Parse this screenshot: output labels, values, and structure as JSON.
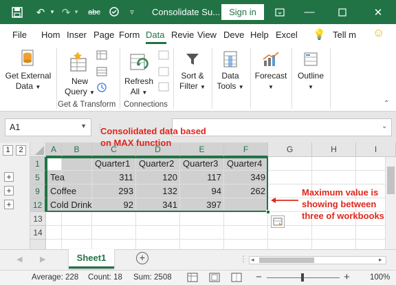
{
  "titlebar": {
    "doc_title": "Consolidate Su...",
    "signin_label": "Sign in",
    "save_icon": "save-icon",
    "undo_icon": "undo-icon",
    "redo_icon": "redo-icon",
    "spelling_label": "abc",
    "accent": "#217346"
  },
  "tabs": [
    "File",
    "Hom",
    "Inser",
    "Page",
    "Form",
    "Data",
    "Revie",
    "View",
    "Deve",
    "Help",
    "Excel"
  ],
  "active_tab": "Data",
  "tell_me": "Tell m",
  "ribbon": {
    "get_external": [
      "Get External",
      "Data"
    ],
    "new_query": [
      "New",
      "Query"
    ],
    "refresh": [
      "Refresh",
      "All"
    ],
    "sort_filter": [
      "Sort &",
      "Filter"
    ],
    "data_tools": [
      "Data",
      "Tools"
    ],
    "forecast": "Forecast",
    "outline": "Outline",
    "group_get_transform": "Get & Transform",
    "group_connections": "Connections"
  },
  "formula_bar": {
    "name_box": "A1",
    "fx_value": ""
  },
  "outline_levels": [
    "1",
    "2"
  ],
  "columns": [
    "A",
    "B",
    "C",
    "D",
    "E",
    "F",
    "G",
    "H",
    "I"
  ],
  "rows": [
    "1",
    "5",
    "9",
    "12",
    "13",
    "14"
  ],
  "table": {
    "headers": [
      "Quarter1",
      "Quarter2",
      "Quarter3",
      "Quarter4"
    ],
    "data": [
      {
        "label": "Tea",
        "values": [
          "311",
          "120",
          "117",
          "349"
        ]
      },
      {
        "label": "Coffee",
        "values": [
          "293",
          "132",
          "94",
          "262"
        ]
      },
      {
        "label": "Cold Drink",
        "values": [
          "92",
          "341",
          "397",
          ""
        ]
      }
    ]
  },
  "sheet_tab": "Sheet1",
  "status": {
    "average": "Average: 228",
    "count": "Count: 18",
    "sum": "Sum: 2508",
    "zoom": "100%"
  },
  "annotations": {
    "top": [
      "Consolidated data based",
      "on MAX function"
    ],
    "right": [
      "Maximum value is",
      "showing between",
      "three of workbooks"
    ]
  }
}
